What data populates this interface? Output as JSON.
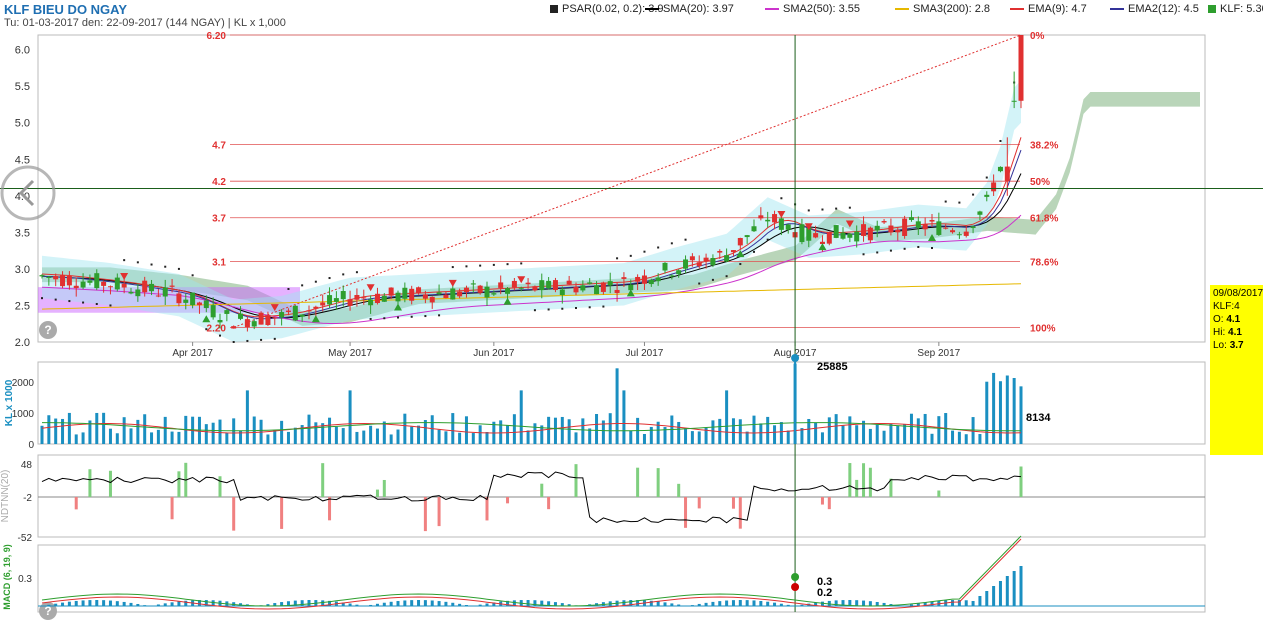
{
  "header": {
    "title": "KLF BIEU DO NGAY",
    "subtitle": "Tu: 01-03-2017 den: 22-09-2017 (144 NGAY) | KL x 1,000"
  },
  "legend": [
    {
      "label": "PSAR(0.02, 0.2): 3.9",
      "color": "#222222",
      "kind": "square"
    },
    {
      "label": "SMA(20): 3.97",
      "color": "#000000",
      "kind": "line"
    },
    {
      "label": "SMA2(50): 3.55",
      "color": "#cc33cc",
      "kind": "line"
    },
    {
      "label": "SMA3(200): 2.8",
      "color": "#e6b800",
      "kind": "line"
    },
    {
      "label": "EMA(9): 4.7",
      "color": "#e03030",
      "kind": "line"
    },
    {
      "label": "EMA2(12): 4.5",
      "color": "#333399",
      "kind": "line"
    },
    {
      "label": "KLF: 5.30",
      "color": "#2e9e2e",
      "kind": "square"
    }
  ],
  "tooltip": {
    "date": "09/08/2017",
    "symbol": "KLF:4",
    "open_label": "O:",
    "open": "4.1",
    "high_label": "Hi:",
    "high": "4.1",
    "low_label": "Lo:",
    "low": "3.7"
  },
  "chart_data": {
    "type": "candlestick",
    "price_axis": {
      "ticks": [
        "6.0",
        "5.5",
        "5.0",
        "4.5",
        "4.0",
        "3.5",
        "3.0",
        "2.5",
        "2.0"
      ],
      "ylim": [
        2.0,
        6.2
      ]
    },
    "x_ticks": [
      "Apr 2017",
      "May 2017",
      "Jun 2017",
      "Jul 2017",
      "Aug 2017",
      "Sep 2017"
    ],
    "fibonacci": {
      "high": 6.2,
      "low": 2.2,
      "levels": [
        {
          "price": 6.2,
          "price_label": "6.20",
          "pct": "0%"
        },
        {
          "price": 4.7,
          "price_label": "4.7",
          "pct": "38.2%"
        },
        {
          "price": 4.2,
          "price_label": "4.2",
          "pct": "50%"
        },
        {
          "price": 3.7,
          "price_label": "3.7",
          "pct": "61.8%"
        },
        {
          "price": 3.1,
          "price_label": "3.1",
          "pct": "78.6%"
        },
        {
          "price": 2.2,
          "price_label": "2.20",
          "pct": "100%"
        }
      ]
    },
    "crosshair_price": 4.1,
    "volume": {
      "axis_label": "KL x 1000",
      "ticks": [
        "2000",
        "1000",
        "0"
      ],
      "annotations": [
        {
          "value": "25885"
        },
        {
          "value": "8134"
        }
      ]
    },
    "oscillator": {
      "axis_label": "NDTNN(20)",
      "ticks": [
        "48",
        "-2",
        "-52"
      ]
    },
    "macd": {
      "axis_label": "MACD (6, 19, 9)",
      "ticks": [
        "0.3"
      ],
      "annotations": [
        {
          "value": "0.3"
        },
        {
          "value": "0.2"
        }
      ]
    }
  }
}
